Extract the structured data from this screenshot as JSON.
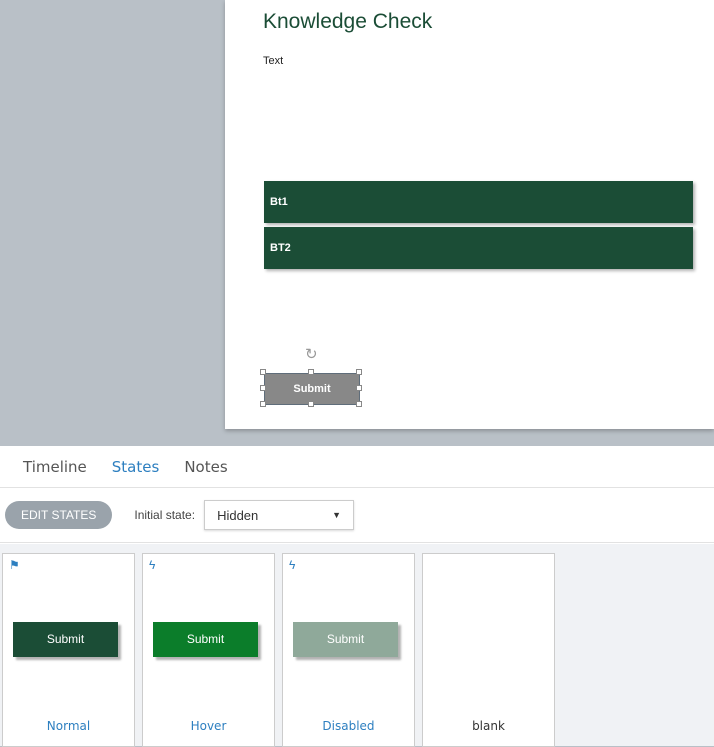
{
  "slide": {
    "title": "Knowledge Check",
    "text": "Text",
    "bt1": "Bt1",
    "bt2": "BT2",
    "submit": "Submit"
  },
  "tabs": [
    "Timeline",
    "States",
    "Notes"
  ],
  "toolbar": {
    "edit": "EDIT STATES",
    "initial_label": "Initial state:",
    "initial_value": "Hidden"
  },
  "states": [
    {
      "name": "Normal",
      "button": "Submit",
      "color": "#1b4d36"
    },
    {
      "name": "Hover",
      "button": "Submit",
      "color": "#0b7d2a"
    },
    {
      "name": "Disabled",
      "button": "Submit",
      "color": "#8fa99a"
    },
    {
      "name": "blank"
    }
  ]
}
